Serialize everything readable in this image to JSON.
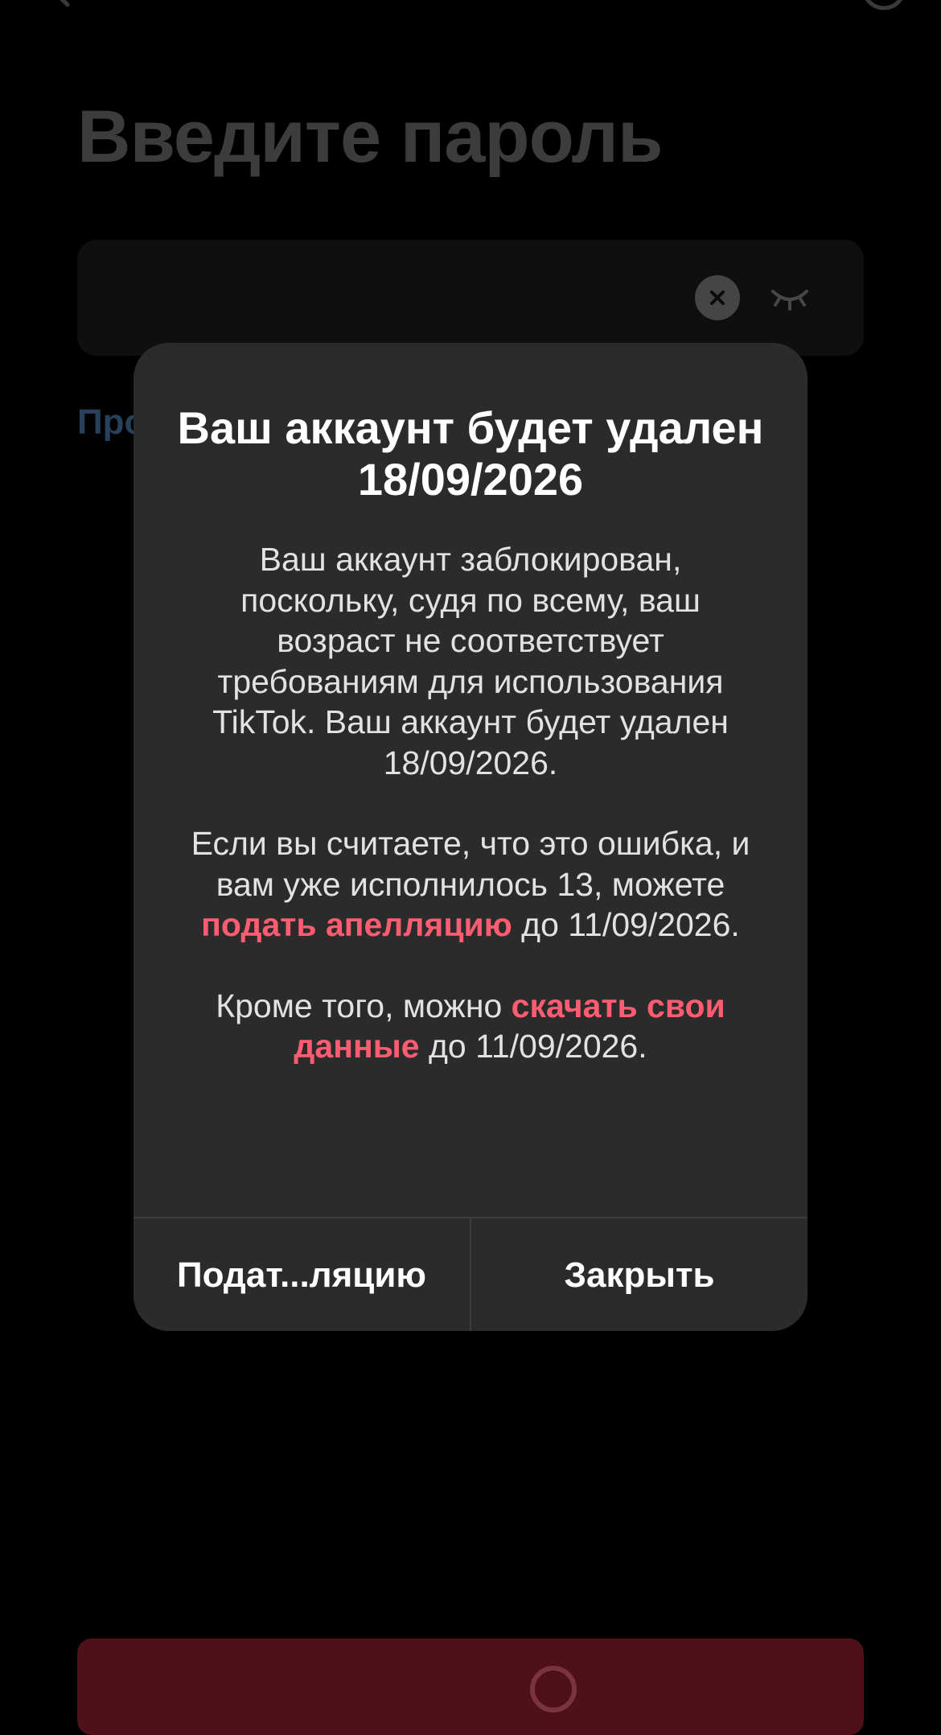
{
  "screen": {
    "title": "Введите пароль",
    "forgot_link": "Про",
    "icons": {
      "back": "back-arrow-icon",
      "help": "help-circle-icon",
      "clear": "clear-x-icon",
      "visibility": "eye-closed-icon",
      "loading": "loading-spinner-icon"
    }
  },
  "dialog": {
    "title": "Ваш аккаунт будет удален 18/09/2026",
    "para1": "Ваш аккаунт заблокирован, поскольку, судя по всему, ваш возраст не соответствует требованиям для использования TikTok. Ваш аккаунт будет удален 18/09/2026.",
    "para2_before": "Если вы считаете, что это ошибка, и вам уже исполнилось 13, можете ",
    "para2_link": "подать апелляцию",
    "para2_after": " до 11/09/2026.",
    "para3_before": "Кроме того, можно ",
    "para3_link": "скачать свои данные",
    "para3_after": " до 11/09/2026.",
    "appeal_button": "Подат...ляцию",
    "close_button": "Закрыть"
  },
  "colors": {
    "background": "#000000",
    "dialog_bg": "#2b2b2c",
    "link": "#fe5c70",
    "dim_title": "#3c3c3c",
    "primary_button_dimmed": "#4e1119"
  }
}
